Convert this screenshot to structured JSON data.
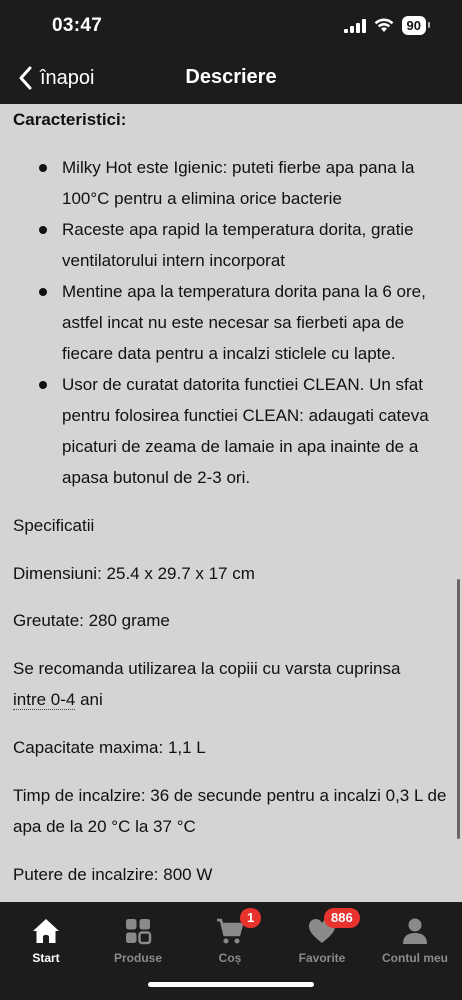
{
  "status": {
    "time": "03:47",
    "battery": "90"
  },
  "nav": {
    "back_label": "înapoi",
    "title": "Descriere"
  },
  "content": {
    "section_heading": "Caracteristici:",
    "bullets": [
      "Milky Hot este Igienic: puteti fierbe apa pana la 100°C pentru a elimina orice bacterie",
      "Raceste apa rapid la temperatura dorita, gratie ventilatorului intern incorporat",
      "Mentine apa la temperatura dorita pana la 6 ore, astfel incat nu este necesar sa fierbeti apa de fiecare data pentru a incalzi sticlele cu lapte.",
      "Usor de curatat datorita functiei CLEAN. Un sfat pentru folosirea functiei CLEAN: adaugati cateva picaturi de zeama de lamaie in apa inainte de a apasa butonul de 2-3 ori."
    ],
    "specs_heading": "Specificatii",
    "dimensions": "Dimensiuni: 25.4 x 29.7 x 17 cm",
    "weight": "Greutate: 280 grame",
    "age_recommendation": "Se recomanda utilizarea la copiii cu varsta cuprinsa",
    "age_range": "intre 0-4",
    "age_suffix": " ani",
    "capacity": "Capacitate maxima: 1,1 L",
    "heating_time": "Timp de incalzire: 36 de secunde pentru a incalzi 0,3 L de apa de la 20 °C la 37 °C",
    "power": "Putere de incalzire: 800 W"
  },
  "tabs": {
    "start": "Start",
    "products": "Produse",
    "cart": "Coș",
    "cart_badge": "1",
    "favorites": "Favorite",
    "favorites_badge": "886",
    "account": "Contul meu"
  },
  "colors": {
    "bar_background": "#1c1c1c",
    "content_background": "#d4d4d4",
    "badge": "#e8322d"
  }
}
